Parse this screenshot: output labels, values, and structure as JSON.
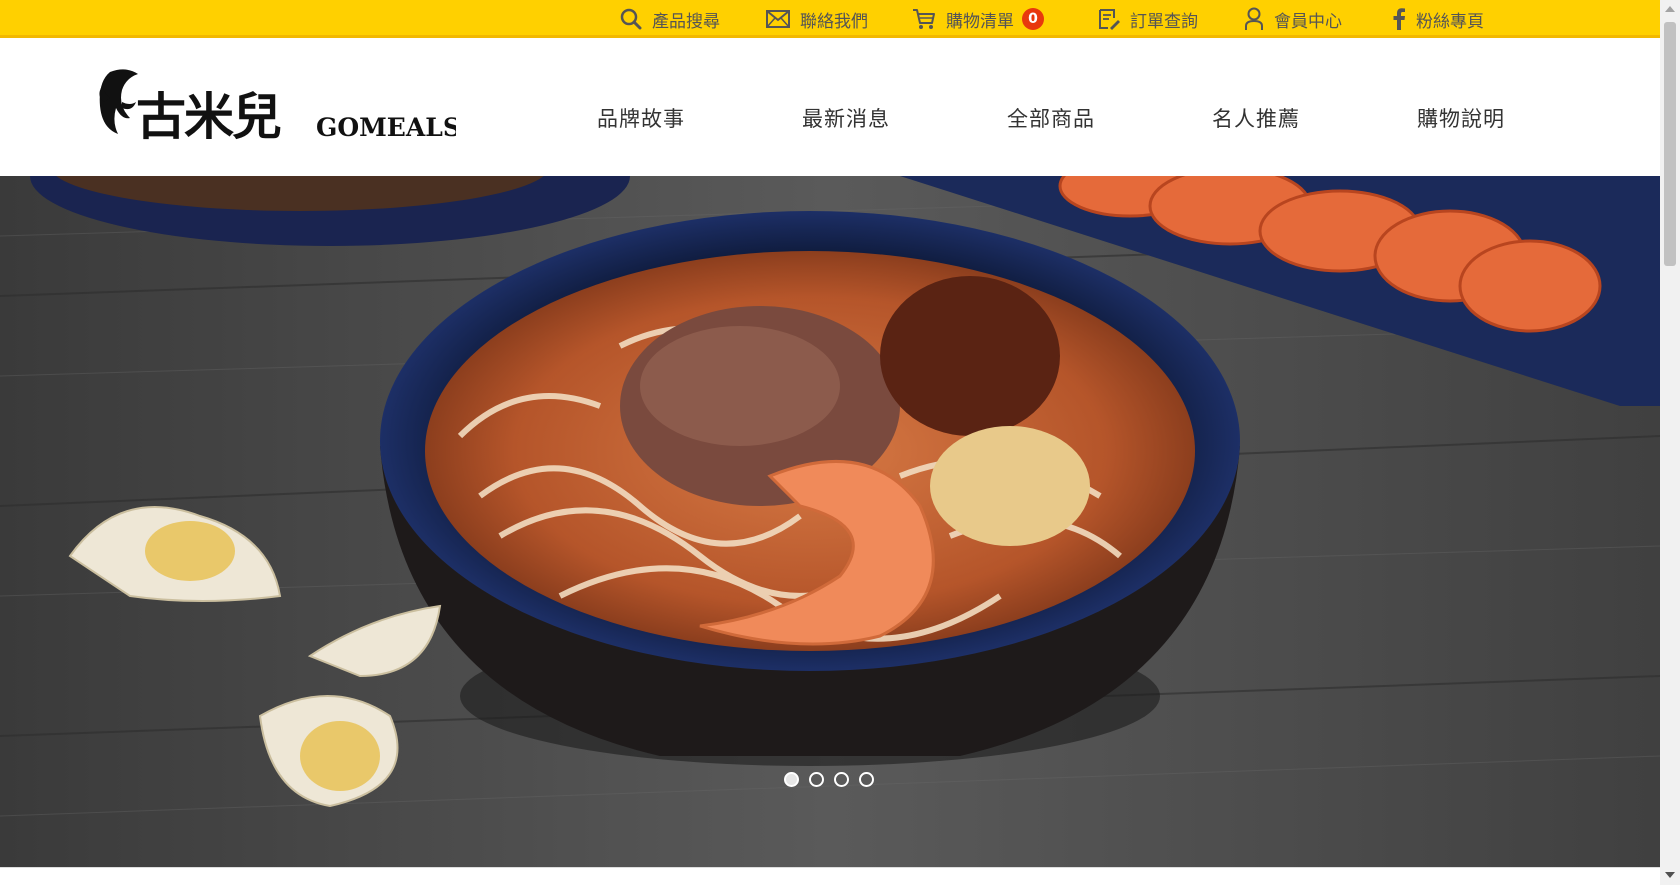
{
  "topbar": {
    "items": [
      {
        "label": "產品搜尋",
        "icon": "search-icon"
      },
      {
        "label": "聯絡我們",
        "icon": "mail-icon"
      },
      {
        "label": "購物清單",
        "icon": "cart-icon",
        "badge": "0"
      },
      {
        "label": "訂單查詢",
        "icon": "order-icon"
      },
      {
        "label": "會員中心",
        "icon": "user-icon"
      },
      {
        "label": "粉絲專頁",
        "icon": "facebook-icon"
      }
    ],
    "background": "#ffd000",
    "badge_color": "#e8380d"
  },
  "header": {
    "logo": {
      "cn": "古米兒",
      "en": "GOMEALS"
    },
    "nav": [
      "品牌故事",
      "最新消息",
      "全部商品",
      "名人推薦",
      "購物說明"
    ]
  },
  "hero": {
    "slide_count": 4,
    "active_slide": 1
  }
}
